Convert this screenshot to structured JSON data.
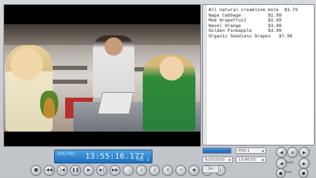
{
  "player": {
    "time_label": "DVR/POS",
    "time": "13:55:16.177",
    "position": "POS 1"
  },
  "controls": [
    {
      "name": "stop-icon",
      "glyph": "■"
    },
    {
      "name": "rewind-icon",
      "glyph": "◀◀"
    },
    {
      "name": "prev-frame-icon",
      "glyph": "|◀"
    },
    {
      "name": "pause-icon",
      "glyph": "❚❚"
    },
    {
      "name": "play-icon",
      "glyph": "▶"
    },
    {
      "name": "next-frame-icon",
      "glyph": "▶|"
    },
    {
      "name": "fast-forward-icon",
      "glyph": "▶▶"
    },
    {
      "name": "speed-down-icon",
      "glyph": "-"
    },
    {
      "name": "speed-1-icon",
      "glyph": "1"
    },
    {
      "name": "speed-2-icon",
      "glyph": "2"
    },
    {
      "name": "speed-4-icon",
      "glyph": "4"
    },
    {
      "name": "speed-up-icon",
      "glyph": "+"
    },
    {
      "name": "snapshot-icon",
      "glyph": "◉"
    },
    {
      "name": "settings-icon",
      "glyph": "⚙"
    },
    {
      "name": "export-icon",
      "glyph": "⇩"
    }
  ],
  "receipt": {
    "lines": [
      "All natural creamline milk  $1.79",
      "Napa Cabbage          $1.99",
      "Red Grapefruit        $1.69",
      "Navel Orange          $3.98",
      "Golden Pineapple      $3.99",
      "Organic Seedless Grapes   $7.98"
    ]
  },
  "panel": {
    "channel_select": "",
    "pos_select": "POS 1",
    "date_select": "6/25/2010",
    "time_select": "13:48:53",
    "go_button": "Go",
    "round_labels": [
      "Back",
      "Fwd",
      "Exit"
    ]
  },
  "colors": {
    "time_bar": "#2a7fd0",
    "receipt_bg": "#ffffff"
  }
}
